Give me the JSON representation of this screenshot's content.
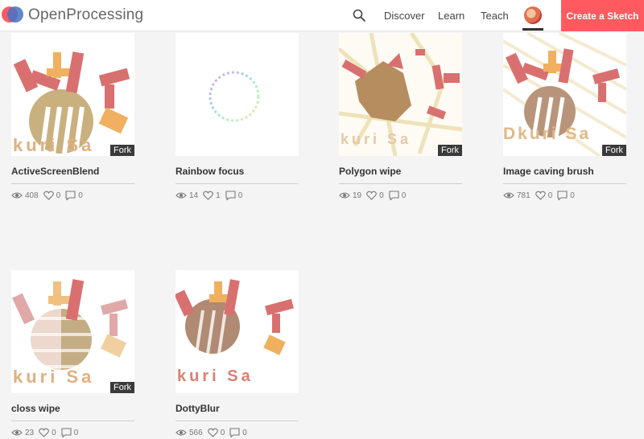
{
  "header": {
    "logo_text": "OpenProcessing",
    "nav": {
      "discover": "Discover",
      "learn": "Learn",
      "teach": "Teach"
    },
    "create_button": "Create a Sketch"
  },
  "sketches": [
    {
      "title": "ActiveScreenBlend",
      "views": "408",
      "likes": "0",
      "comments": "0",
      "fork_label": "Fork"
    },
    {
      "title": "Rainbow focus",
      "views": "14",
      "likes": "1",
      "comments": "0"
    },
    {
      "title": "Polygon wipe",
      "views": "19",
      "likes": "0",
      "comments": "0",
      "fork_label": "Fork"
    },
    {
      "title": "Image caving brush",
      "views": "781",
      "likes": "0",
      "comments": "0",
      "fork_label": "Fork"
    },
    {
      "title": "closs wipe",
      "views": "23",
      "likes": "0",
      "comments": "0",
      "fork_label": "Fork"
    },
    {
      "title": "DottyBlur",
      "views": "566",
      "likes": "0",
      "comments": "0"
    }
  ],
  "thumb_text": {
    "kurisa": "kuri Sa",
    "kurisa_full": "Dkuri Sa"
  },
  "colors": {
    "accent": "#ff5a5f",
    "background": "#f4f4f4"
  }
}
